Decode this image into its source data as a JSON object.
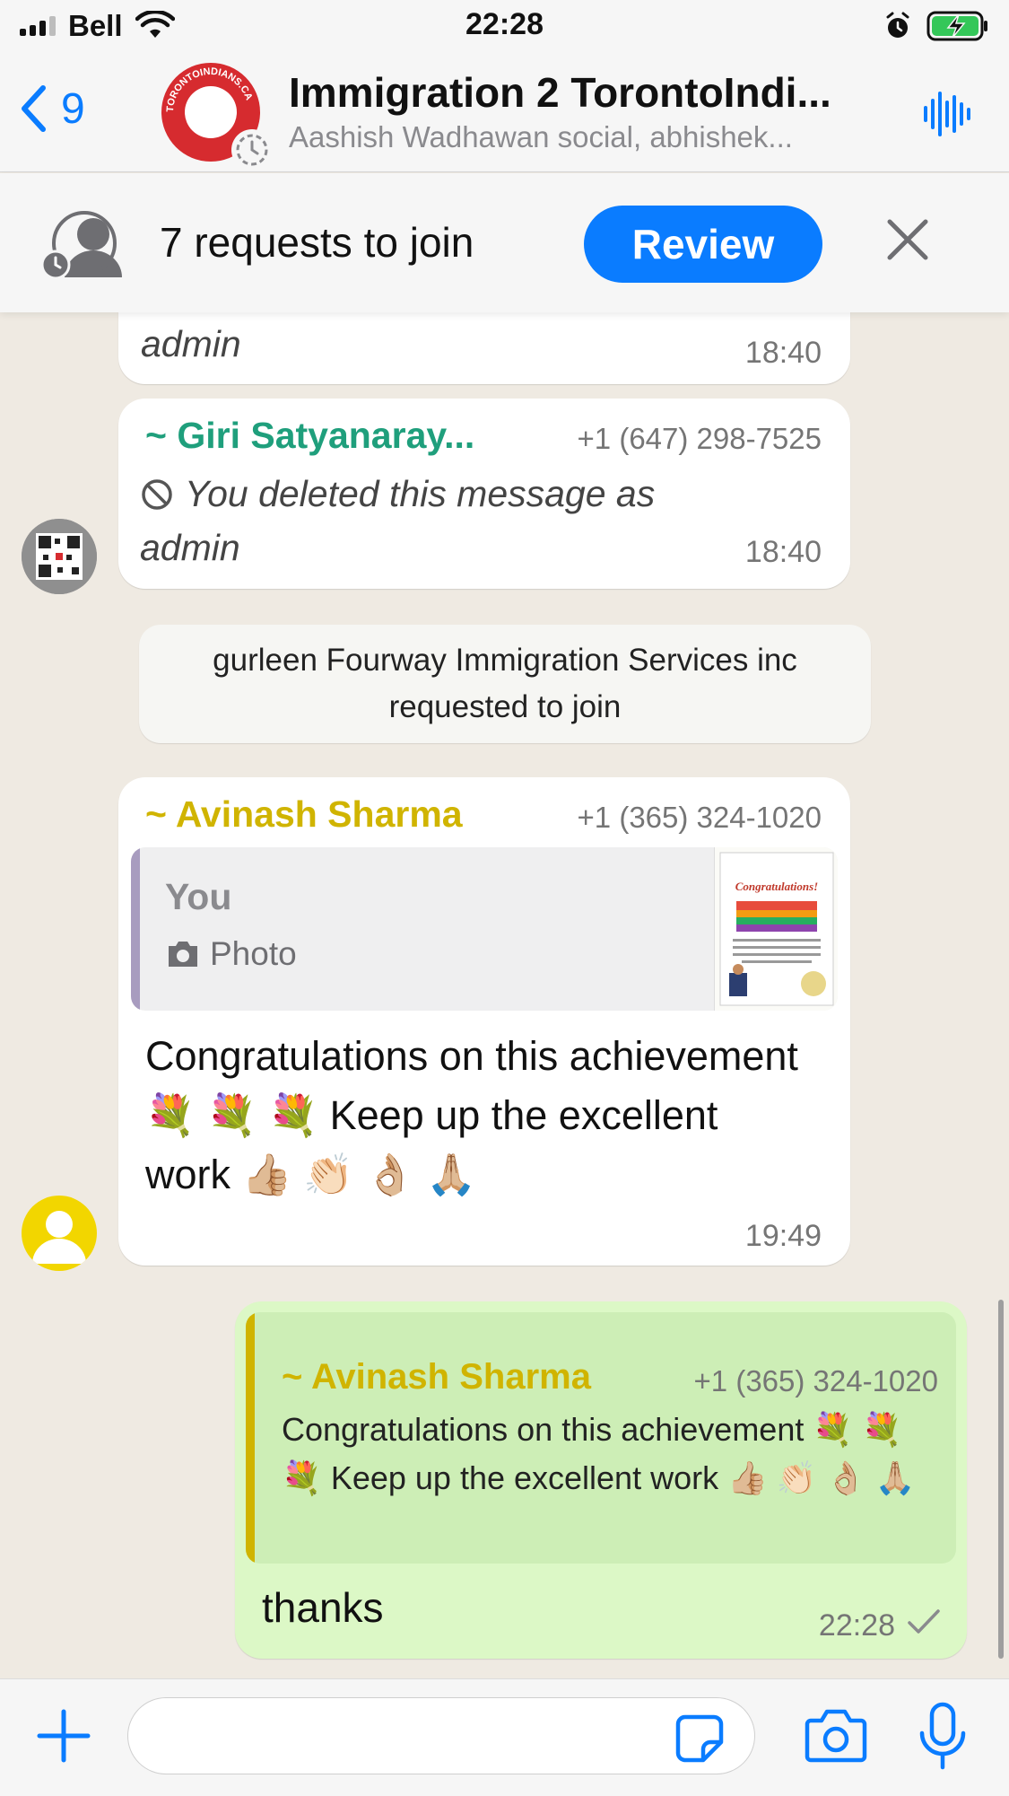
{
  "status_bar": {
    "carrier": "Bell",
    "time": "22:28"
  },
  "header": {
    "back_count": "9",
    "title": "Immigration 2 TorontoIndi...",
    "subtitle": "Aashish Wadhawan social, abhishek...",
    "avatar_ring_text": "TORONTOINDIANS.CA"
  },
  "requests_banner": {
    "text": "7 requests to join",
    "review_label": "Review"
  },
  "messages": {
    "top_partial": {
      "text": "admin",
      "time": "18:40"
    },
    "giri": {
      "sender": "~ Giri Satyanaray...",
      "phone": "+1 (647) 298-7525",
      "deleted_text": "You deleted this message as admin",
      "time": "18:40"
    },
    "system": {
      "text": "gurleen Fourway Immigration Services inc requested to join"
    },
    "avinash": {
      "sender": "~ Avinash Sharma",
      "phone": "+1 (365) 324-1020",
      "quote_name": "You",
      "quote_type": "Photo",
      "thumb_title": "Congratulations!",
      "body": "Congratulations on this achievement 💐 💐 💐  Keep up the excellent work 👍🏼 👏🏻 👌🏼 🙏🏼",
      "time": "19:49"
    },
    "outgoing": {
      "quote_sender": "~ Avinash Sharma",
      "quote_phone": "+1 (365) 324-1020",
      "quote_text": "Congratulations on this achievement 💐 💐 💐  Keep up the excellent work 👍🏼 👏🏻 👌🏼 🙏🏼",
      "body": "thanks",
      "time": "22:28"
    }
  },
  "input_bar": {
    "placeholder": ""
  },
  "colors": {
    "accent_blue": "#0a7cff",
    "chat_background": "#efeae2",
    "outgoing_bubble": "#dcf8c6",
    "giri_name": "#1f9f7c",
    "avinash_name": "#d0b400"
  },
  "icons": [
    "signal-icon",
    "wifi-icon",
    "alarm-icon",
    "battery-charging-icon",
    "back-chevron-icon",
    "disappearing-timer-icon",
    "audio-call-icon",
    "join-requests-icon",
    "close-icon",
    "deleted-ban-icon",
    "camera-small-icon",
    "double-check-icon",
    "plus-icon",
    "sticker-icon",
    "camera-icon",
    "mic-icon"
  ]
}
